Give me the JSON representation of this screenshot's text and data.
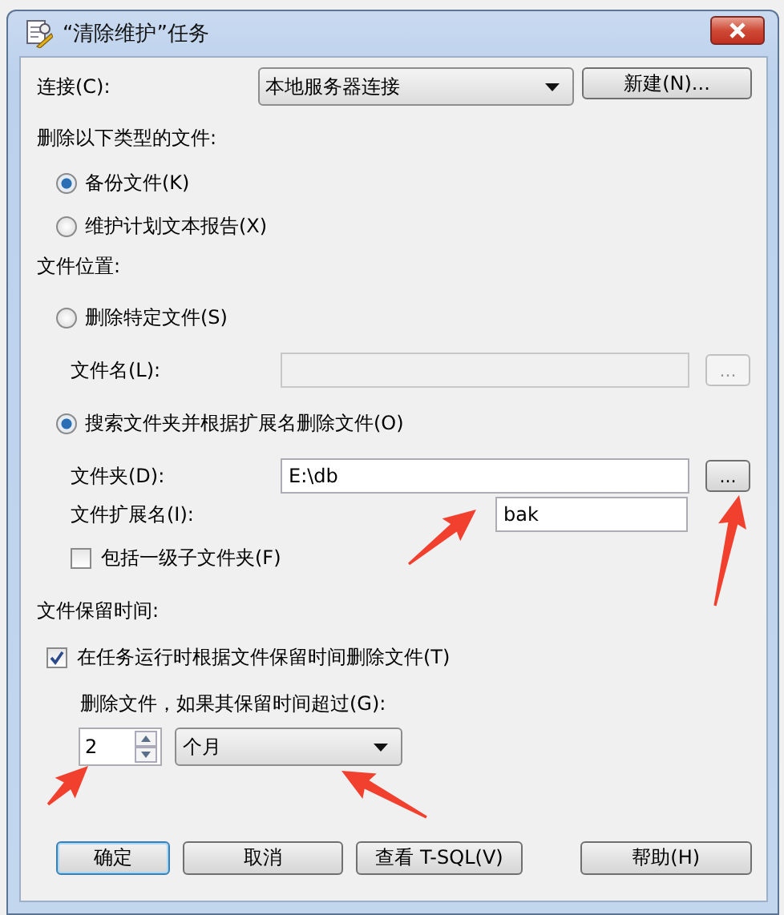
{
  "window": {
    "title": "“清除维护”任务"
  },
  "connection": {
    "label": "连接(C):",
    "value": "本地服务器连接",
    "new_button": "新建(N)..."
  },
  "file_type": {
    "label": "删除以下类型的文件:",
    "options": [
      {
        "label": "备份文件(K)",
        "selected": true
      },
      {
        "label": "维护计划文本报告(X)",
        "selected": false
      }
    ]
  },
  "file_location": {
    "label": "文件位置:",
    "specific": {
      "label": "删除特定文件(S)",
      "selected": false,
      "file_name_label": "文件名(L):",
      "disabled": true,
      "browse": "..."
    },
    "search": {
      "label": "搜索文件夹并根据扩展名删除文件(O)",
      "selected": true,
      "folder_label": "文件夹(D):",
      "folder": "E:\\db",
      "browse": "...",
      "extension_label": "文件扩展名(I):",
      "extension": "bak",
      "subfolders": {
        "label": "包括一级子文件夹(F)",
        "checked": false
      }
    }
  },
  "retention": {
    "label": "文件保留时间:",
    "delete_by_age": {
      "label": "在任务运行时根据文件保留时间删除文件(T)",
      "checked": true
    },
    "age_label": "删除文件，如果其保留时间超过(G):",
    "amount": "2",
    "unit": "个月"
  },
  "buttons": [
    {
      "label": "确定",
      "default": true
    },
    {
      "label": "取消",
      "default": false
    },
    {
      "label": "查看 T-SQL(V)",
      "default": false
    },
    {
      "label": "帮助(H)",
      "default": false
    }
  ]
}
